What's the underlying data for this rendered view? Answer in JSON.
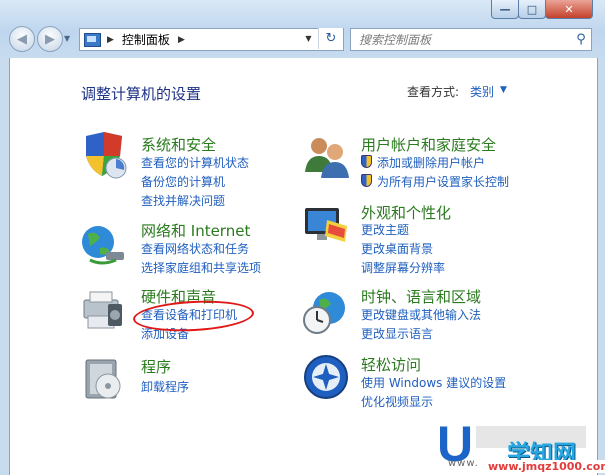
{
  "navigation": {
    "breadcrumb": "控制面板",
    "search_placeholder": "搜索控制面板"
  },
  "header": {
    "title": "调整计算机的设置",
    "view_label": "查看方式:",
    "view_value": "类别"
  },
  "categories": [
    {
      "title": "系统和安全",
      "links": [
        "查看您的计算机状态",
        "备份您的计算机",
        "查找并解决问题"
      ]
    },
    {
      "title": "网络和 Internet",
      "links": [
        "查看网络状态和任务",
        "选择家庭组和共享选项"
      ]
    },
    {
      "title": "硬件和声音",
      "links": [
        "查看设备和打印机",
        "添加设备"
      ]
    },
    {
      "title": "程序",
      "links": [
        "卸载程序"
      ]
    },
    {
      "title": "用户帐户和家庭安全",
      "links": [
        "添加或删除用户帐户",
        "为所有用户设置家长控制"
      ]
    },
    {
      "title": "外观和个性化",
      "links": [
        "更改主题",
        "更改桌面背景",
        "调整屏幕分辨率"
      ]
    },
    {
      "title": "时钟、语言和区域",
      "links": [
        "更改键盘或其他输入法",
        "更改显示语言"
      ]
    },
    {
      "title": "轻松访问",
      "links": [
        "使用 Windows 建议的设置",
        "优化视频显示"
      ]
    }
  ],
  "watermark": {
    "letter": "U",
    "site": "www.",
    "brand": "学知网",
    "url": "www.jmqz1000.com"
  },
  "colors": {
    "link": "#1f5fbf",
    "category_title": "#2a7a1e",
    "page_title": "#1e3287",
    "highlight_circle": "#e01818"
  }
}
